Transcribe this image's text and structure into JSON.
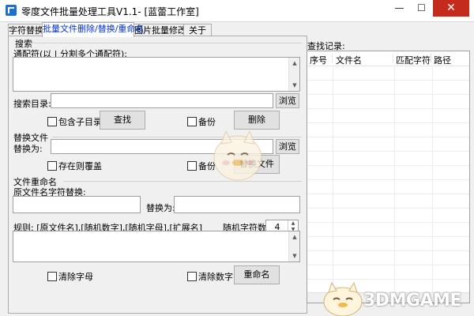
{
  "window": {
    "title": "零度文件批量处理工具V1.1- [蓝蕾工作室]",
    "minimize_glyph": "—",
    "maximize_glyph": "☐",
    "close_glyph": "✕"
  },
  "tabs": [
    {
      "label": "字符替换",
      "active": false
    },
    {
      "label": "批量文件删除/替换/重命名",
      "active": true
    },
    {
      "label": "图片批量修改",
      "active": false
    },
    {
      "label": "关于",
      "active": false
    }
  ],
  "search": {
    "group_label": "搜索",
    "wildcard_label": "通配符(以 | 分割多个通配符):",
    "wildcard_value": "",
    "dir_label": "搜索目录:",
    "dir_value": "",
    "browse_label": "浏览",
    "include_subdirs_label": "包含子目录",
    "find_label": "查找",
    "backup_label": "备份",
    "delete_label": "删除"
  },
  "replace": {
    "group_label": "替换文件",
    "replace_with_label": "替换为:",
    "replace_with_value": "",
    "browse_label": "浏览",
    "overwrite_label": "存在则覆盖",
    "backup_label": "备份",
    "replace_button_label": "替换文件"
  },
  "rename": {
    "group_label": "文件重命名",
    "original_label": "原文件名字符替换:",
    "original_value": "",
    "replace_with_label": "替换为:",
    "replace_with_value": "",
    "rules_label": "规则: [原文件名],[随机数字],[随机字母],[扩展名]",
    "random_count_label": "随机字符数:",
    "random_count_value": "4",
    "rules_value": "",
    "clear_letters_label": "清除字母",
    "clear_digits_label": "清除数字",
    "rename_button_label": "重命名"
  },
  "history": {
    "label": "查找记录:",
    "columns": [
      "序号",
      "文件名",
      "匹配字符",
      "路径"
    ],
    "rows": []
  },
  "watermark": {
    "text": "3DMGAME"
  },
  "icons": {
    "app": "app-icon",
    "spin_up": "▲",
    "spin_down": "▼",
    "scroll_up": "▲",
    "scroll_down": "▼"
  }
}
